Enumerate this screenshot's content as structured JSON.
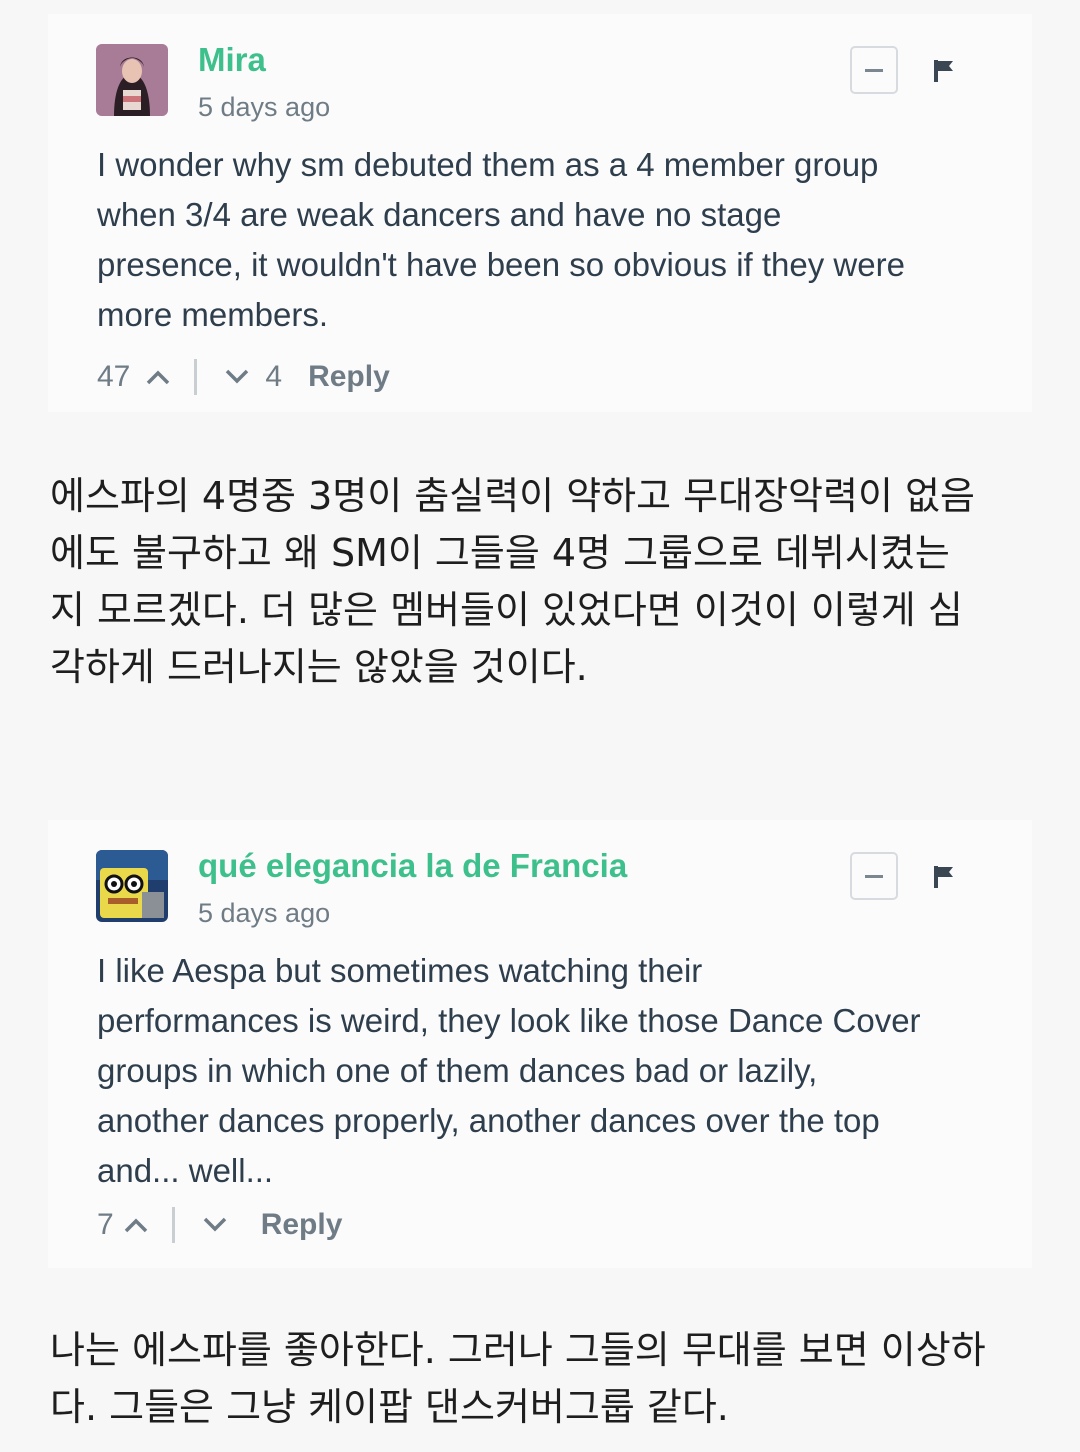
{
  "comments": [
    {
      "username": "Mira",
      "time": "5 days ago",
      "text": "I wonder why sm debuted them as a 4 member group\nwhen 3/4 are weak dancers and have no stage\npresence, it wouldn't have been so obvious if they were\nmore members.",
      "upvotes": "47",
      "downvotes": "4",
      "reply_label": "Reply",
      "translation": "에스파의 4명중 3명이 춤실력이 약하고 무대장악력이 없음\n에도 불구하고 왜 SM이 그들을 4명 그룹으로 데뷔시켰는\n지 모르겠다. 더 많은 멤버들이 있었다면 이것이 이렇게 심\n각하게 드러나지는 않았을 것이다."
    },
    {
      "username": "qué elegancia la de Francia",
      "time": "5 days ago",
      "text": "I like Aespa but sometimes watching their\nperformances is weird, they look like those Dance Cover\ngroups in which one of them dances bad or lazily,\nanother dances properly, another dances over the top\nand... well...",
      "upvotes": "7",
      "downvotes": "",
      "reply_label": "Reply",
      "translation": "나는 에스파를 좋아한다. 그러나 그들의 무대를 보면 이상하\n다. 그들은 그냥 케이팝 댄스커버그룹 같다."
    }
  ],
  "icons": {
    "collapse": "minus-icon",
    "flag": "flag-icon",
    "upvote": "chevron-up-icon",
    "downvote": "chevron-down-icon"
  },
  "colors": {
    "username": "#3ec08c",
    "meta": "#6f7c86",
    "body_text": "#2e3e4c"
  }
}
